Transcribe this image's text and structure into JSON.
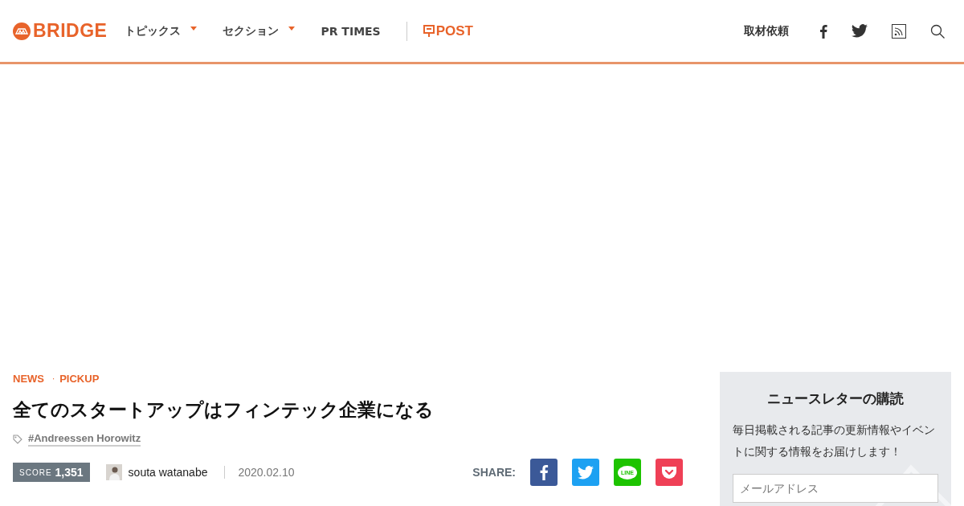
{
  "header": {
    "logo": "BRIDGE",
    "nav": [
      {
        "label": "トピックス",
        "dropdown": true
      },
      {
        "label": "セクション",
        "dropdown": true
      },
      {
        "label": "PR TIMES",
        "dropdown": false
      }
    ],
    "post_logo": "POST",
    "request_link": "取材依頼"
  },
  "article": {
    "categories": [
      "NEWS",
      "PICKUP"
    ],
    "category_separator": "·",
    "title": "全てのスタートアップはフィンテック企業になる",
    "tag": "#Andreessen Horowitz",
    "score_label": "SCORE",
    "score": "1,351",
    "author": "souta watanabe",
    "date": "2020.02.10",
    "share_label": "SHARE:",
    "share": [
      {
        "kind": "facebook"
      },
      {
        "kind": "twitter"
      },
      {
        "kind": "line",
        "label": "LINE"
      },
      {
        "kind": "pocket"
      }
    ]
  },
  "newsletter": {
    "title": "ニュースレターの購読",
    "text": "毎日掲載される記事の更新情報やイベントに関する情報をお届けします！",
    "placeholder": "メールアドレス"
  }
}
